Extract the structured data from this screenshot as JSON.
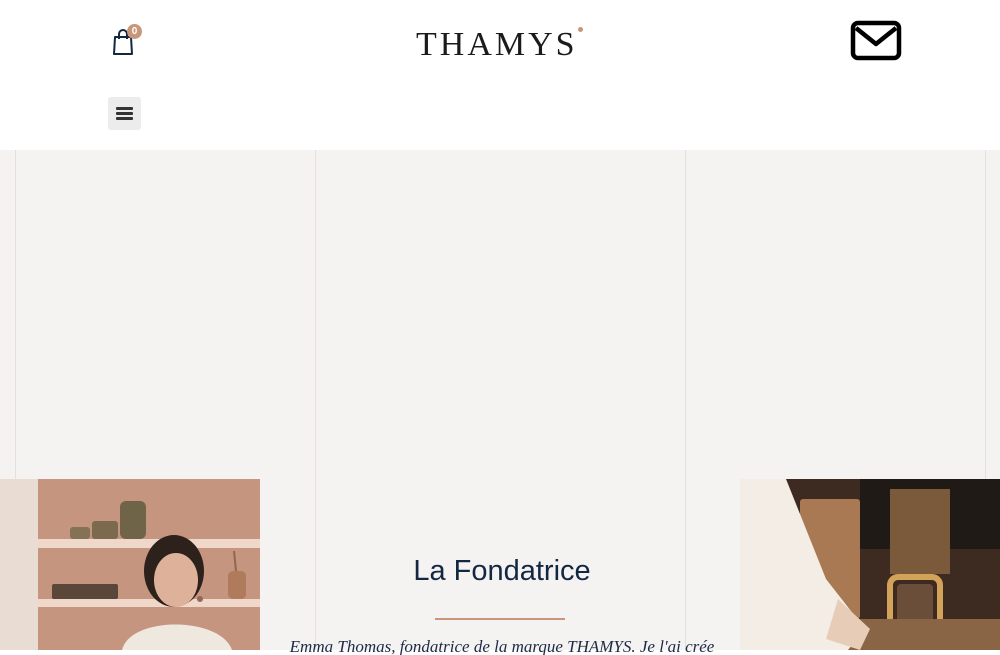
{
  "header": {
    "logo_text": "THAMYS",
    "cart_count": "0",
    "cart_icon": "shopping-bag-icon",
    "mail_icon": "envelope-icon",
    "menu_icon": "hamburger-menu-icon"
  },
  "colors": {
    "accent": "#c8977a",
    "heading": "#142741",
    "hero_bg": "#f5f3f1"
  },
  "founder_section": {
    "heading": "La Fondatrice",
    "intro_text": "Emma Thomas, fondatrice de la marque THAMYS. Je l'ai crée"
  }
}
